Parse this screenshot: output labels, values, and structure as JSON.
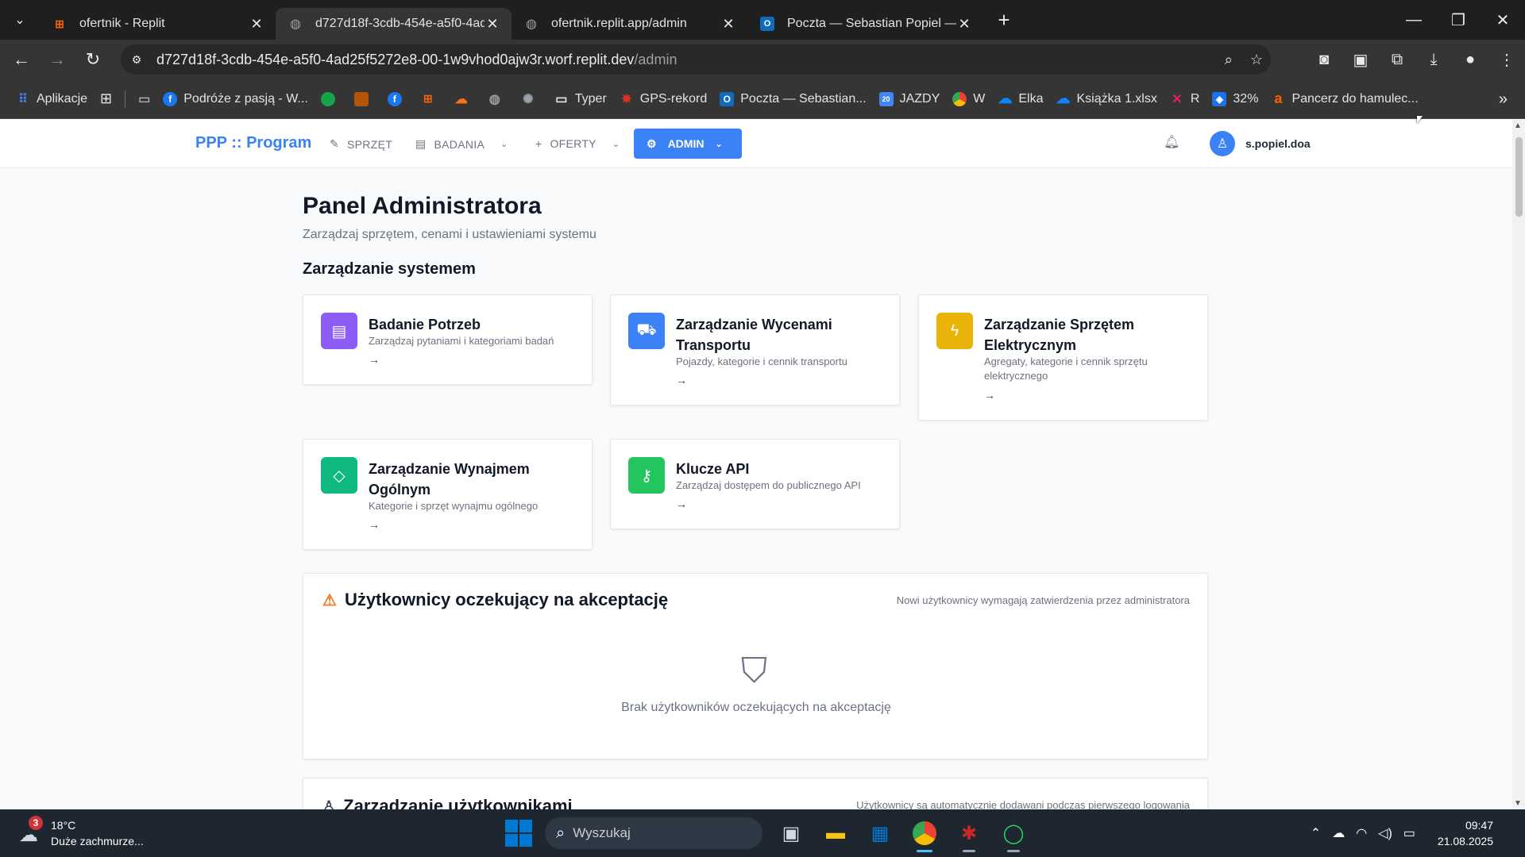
{
  "browser": {
    "tabs": [
      {
        "title": "ofertnik - Replit",
        "icon_color": "#f26207",
        "active": false
      },
      {
        "title": "d727d18f-3cdb-454e-a5f0-4ad",
        "icon_color": "#9aa0a6",
        "active": true
      },
      {
        "title": "ofertnik.replit.app/admin",
        "icon_color": "#9aa0a6",
        "active": false
      },
      {
        "title": "Poczta — Sebastian Popiel — O",
        "icon_color": "#0f6cbd",
        "active": false
      }
    ],
    "url_host": "d727d18f-3cdb-454e-a5f0-4ad25f5272e8-00-1w9vhod0ajw3r.worf.replit.dev",
    "url_path": "/admin",
    "bookmarks": [
      {
        "label": "Aplikacje",
        "icon": "apps-grid",
        "color": "#4285f4"
      },
      {
        "label": "Podróże z pasją - W...",
        "icon": "facebook",
        "color": "#1877f2"
      },
      {
        "label": "Typer",
        "icon": "folder",
        "color": "#9aa0a6"
      },
      {
        "label": "GPS-rekord",
        "icon": "gps",
        "color": "#d93025"
      },
      {
        "label": "Poczta — Sebastian...",
        "icon": "outlook",
        "color": "#0f6cbd"
      },
      {
        "label": "JAZDY",
        "icon": "calendar",
        "color": "#4285f4"
      },
      {
        "label": "W",
        "icon": "chrome",
        "color": "#ea4335"
      },
      {
        "label": "Elka",
        "icon": "onedrive",
        "color": "#0a84ff"
      },
      {
        "label": "Książka 1.xlsx",
        "icon": "onedrive",
        "color": "#0a84ff"
      },
      {
        "label": "R",
        "icon": "r-logo",
        "color": "#e91e63"
      },
      {
        "label": "32%",
        "icon": "gift",
        "color": "#1a73e8"
      },
      {
        "label": "Pancerz do hamulec...",
        "icon": "allegro",
        "color": "#ff5a00"
      }
    ]
  },
  "app": {
    "brand": "PPP :: Program",
    "nav": {
      "sprzet": "SPRZĘT",
      "badania": "BADANIA",
      "oferty": "OFERTY",
      "admin": "ADMIN"
    },
    "username": "s.popiel.doa"
  },
  "page": {
    "title": "Panel Administratora",
    "subtitle": "Zarządzaj sprzętem, cenami i ustawieniami systemu",
    "section_title": "Zarządzanie systemem",
    "cards": [
      {
        "title": "Badanie Potrzeb",
        "desc": "Zarządzaj pytaniami i kategoriami badań",
        "arrow": "→",
        "color": "#8b5cf6",
        "icon": "clipboard-icon"
      },
      {
        "title": "Zarządzanie Wycenami Transportu",
        "desc": "Pojazdy, kategorie i cennik transportu",
        "arrow": "→",
        "color": "#3b82f6",
        "icon": "truck-icon"
      },
      {
        "title": "Zarządzanie Sprzętem Elektrycznym",
        "desc": "Agregaty, kategorie i cennik sprzętu elektrycznego",
        "arrow": "→",
        "color": "#eab308",
        "icon": "lightning-icon"
      },
      {
        "title": "Zarządzanie Wynajmem Ogólnym",
        "desc": "Kategorie i sprzęt wynajmu ogólnego",
        "arrow": "→",
        "color": "#10b981",
        "icon": "box-icon"
      },
      {
        "title": "Klucze API",
        "desc": "Zarządzaj dostępem do publicznego API",
        "arrow": "→",
        "color": "#22c55e",
        "icon": "key-icon"
      }
    ],
    "pending_panel": {
      "title": "Użytkownicy oczekujący na akceptację",
      "note": "Nowi użytkownicy wymagają zatwierdzenia przez administratora",
      "empty_text": "Brak użytkowników oczekujących na akceptację"
    },
    "users_panel": {
      "title": "Zarządzanie użytkownikami",
      "note": "Użytkownicy są automatycznie dodawani podczas pierwszego logowania"
    }
  },
  "taskbar": {
    "weather_temp": "18°C",
    "weather_desc": "Duże zachmurze...",
    "weather_badge": "3",
    "search_placeholder": "Wyszukaj",
    "time": "09:47",
    "date": "21.08.2025"
  }
}
